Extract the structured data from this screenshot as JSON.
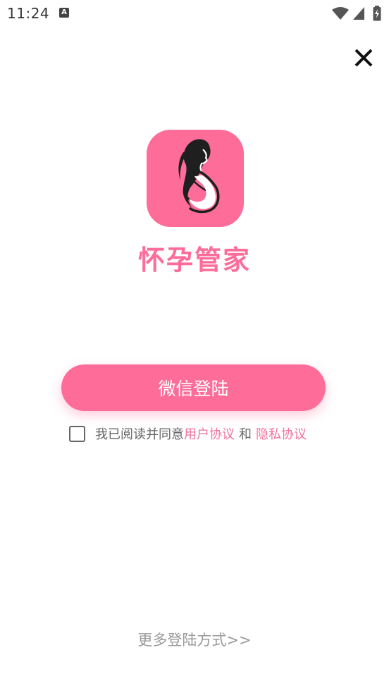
{
  "status_bar": {
    "time": "11:24",
    "notification_glyph": "A",
    "icons": [
      "notification-icon",
      "wifi-icon",
      "signal-icon",
      "battery-charging-icon"
    ]
  },
  "header": {
    "close_icon": "close-icon"
  },
  "app": {
    "logo_icon": "pregnant-woman-icon",
    "name": "怀孕管家"
  },
  "login": {
    "wechat_label": "微信登陆",
    "agreement_prefix": "我已阅读并同意",
    "user_agreement": "用户协议",
    "conjunction": "和",
    "privacy_policy": "隐私协议",
    "agreement_checked": false,
    "more_login": "更多登陆方式>>"
  },
  "colors": {
    "accent": "#fe6c9a",
    "link": "#f2739c",
    "text_gray": "#666666",
    "muted": "#9a9a9a"
  }
}
